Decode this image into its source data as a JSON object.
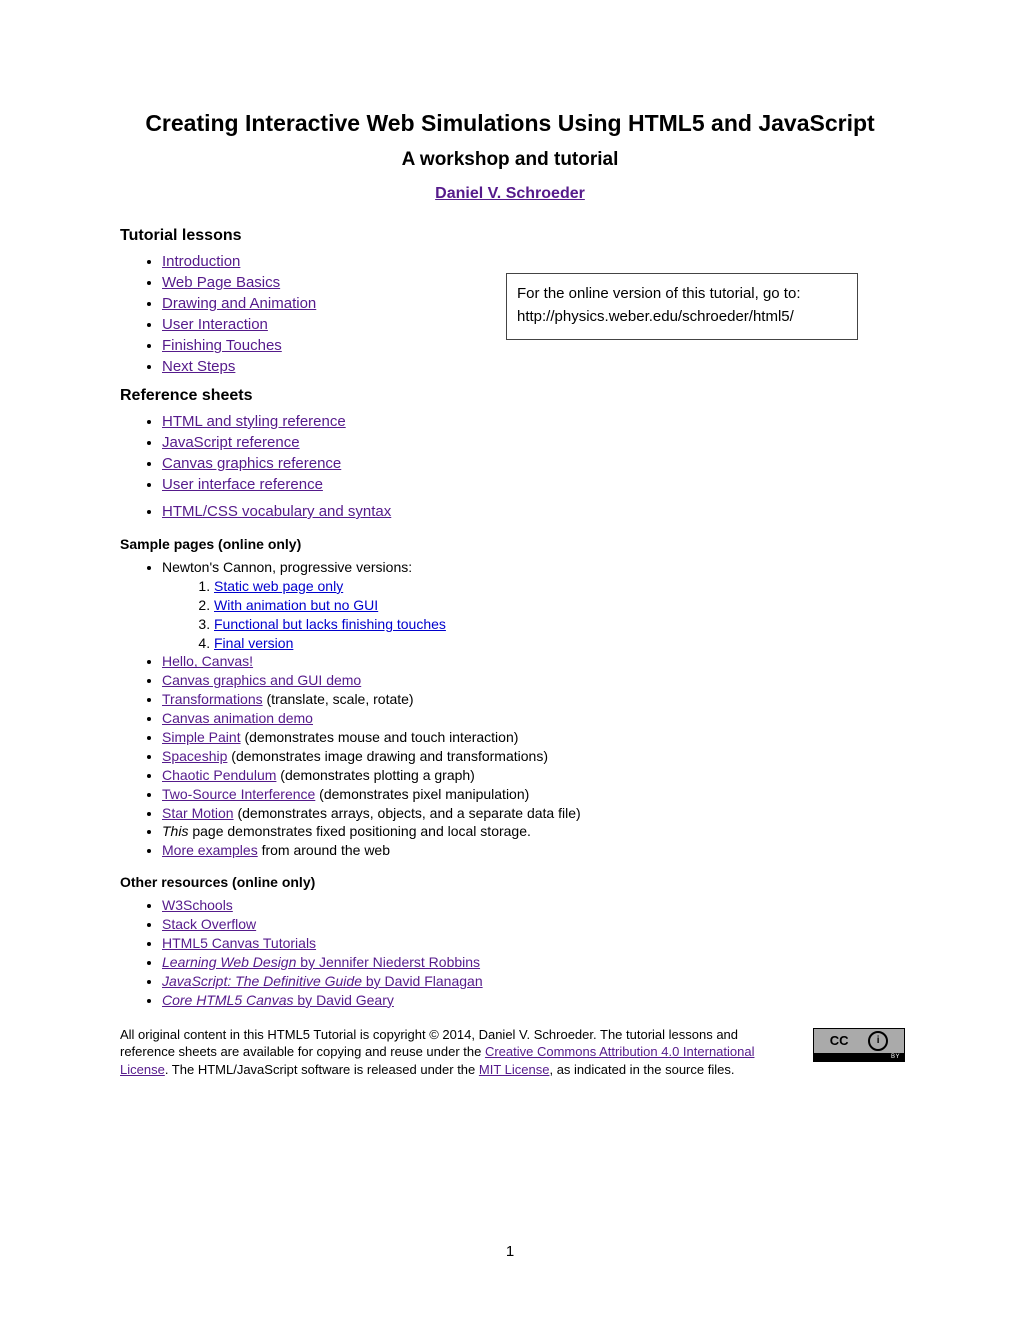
{
  "title": "Creating Interactive Web Simulations Using HTML5 and JavaScript",
  "subtitle": "A workshop and tutorial",
  "author": "Daniel V. Schroeder",
  "sections": {
    "tutorial_lessons": {
      "heading": "Tutorial lessons",
      "items": [
        "Introduction",
        "Web Page Basics",
        "Drawing and Animation",
        "User Interaction",
        "Finishing Touches",
        "Next Steps"
      ]
    },
    "reference_sheets": {
      "heading": "Reference sheets",
      "items": [
        "HTML and styling reference",
        "JavaScript reference",
        "Canvas graphics reference",
        "User interface reference"
      ],
      "extra": "HTML/CSS vocabulary and syntax"
    },
    "sample_pages": {
      "heading": "Sample pages (online only)",
      "newton_label": "Newton's Cannon, progressive versions:",
      "newton_versions": [
        "Static web page only",
        "With animation but no GUI",
        "Functional but lacks finishing touches",
        "Final version"
      ],
      "items": [
        {
          "link": "Hello, Canvas!",
          "after": ""
        },
        {
          "link": "Canvas graphics and GUI demo",
          "after": ""
        },
        {
          "link": "Transformations",
          "after": " (translate, scale, rotate)"
        },
        {
          "link": "Canvas animation demo",
          "after": ""
        },
        {
          "link": "Simple Paint",
          "after": " (demonstrates mouse and touch interaction)"
        },
        {
          "link": "Spaceship",
          "after": " (demonstrates image drawing and transformations)"
        },
        {
          "link": "Chaotic Pendulum",
          "after": " (demonstrates plotting a graph)"
        },
        {
          "link": "Two-Source Interference",
          "after": " (demonstrates pixel manipulation)"
        },
        {
          "link": "Star Motion",
          "after": " (demonstrates arrays, objects, and a separate data file)"
        }
      ],
      "this_page": " page demonstrates fixed positioning and local storage.",
      "this_label": "This",
      "more_link": "More examples",
      "more_after": " from around the web"
    },
    "other_resources": {
      "heading": "Other resources (online only)",
      "items": [
        {
          "link": "W3Schools",
          "italic": false
        },
        {
          "link": "Stack Overflow",
          "italic": false
        },
        {
          "link": "HTML5 Canvas Tutorials",
          "italic": false
        }
      ],
      "books": [
        {
          "title": "Learning Web Design",
          "rest": " by Jennifer Niederst Robbins"
        },
        {
          "title": "JavaScript: The Definitive Guide",
          "rest": " by David Flanagan"
        },
        {
          "title": "Core HTML5 Canvas",
          "rest": " by David Geary"
        }
      ]
    }
  },
  "online_box": {
    "line1": "For the online version of this tutorial, go to:",
    "line2": "http://physics.weber.edu/schroeder/html5/"
  },
  "footer": {
    "t1": "All original content in this HTML5 Tutorial is copyright © 2014, Daniel V. Schroeder. The tutorial lessons and reference sheets are available for copying and reuse under the ",
    "cc_link": "Creative Commons Attribution 4.0 International License",
    "t2": ". The HTML/JavaScript software is released under the ",
    "mit_link": "MIT License",
    "t3": ", as indicated in the source files."
  },
  "cc_badge": {
    "cc": "CC",
    "by": "BY"
  },
  "page_number": "1"
}
